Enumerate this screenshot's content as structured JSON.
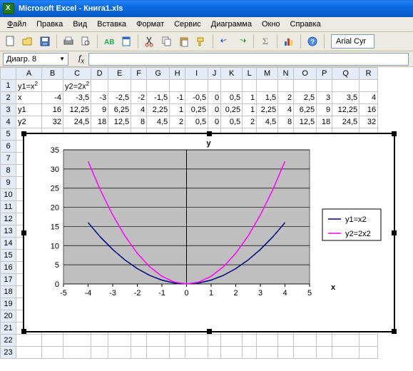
{
  "window": {
    "title": "Microsoft Excel - Книга1.xls"
  },
  "menu": {
    "file": "Файл",
    "edit": "Правка",
    "view": "Вид",
    "insert": "Вставка",
    "format": "Формат",
    "service": "Сервис",
    "chart": "Диаграмма",
    "window": "Окно",
    "help": "Справка"
  },
  "font": {
    "name": "Arial Cyr"
  },
  "namebox": {
    "value": "Диагр. 8"
  },
  "columns": [
    "A",
    "B",
    "C",
    "D",
    "E",
    "F",
    "G",
    "H",
    "I",
    "J",
    "K",
    "L",
    "M",
    "N",
    "O",
    "P",
    "Q",
    "R"
  ],
  "rows": [
    "1",
    "2",
    "3",
    "4",
    "5",
    "6",
    "7",
    "8",
    "9",
    "10",
    "11",
    "12",
    "13",
    "14",
    "15",
    "16",
    "17",
    "18",
    "19",
    "20",
    "21",
    "22",
    "23"
  ],
  "cells": {
    "r1": {
      "A": "y1=x",
      "C": "y2=2x"
    },
    "sup": "2",
    "r2": {
      "A": "x",
      "B": "-4",
      "C": "-3,5",
      "D": "-3",
      "E": "-2,5",
      "F": "-2",
      "G": "-1,5",
      "H": "-1",
      "I": "-0,5",
      "J": "0",
      "K": "0,5",
      "L": "1",
      "M": "1,5",
      "N": "2",
      "O": "2,5",
      "P": "3",
      "Q": "3,5",
      "R": "4"
    },
    "r3": {
      "A": "y1",
      "B": "16",
      "C": "12,25",
      "D": "9",
      "E": "6,25",
      "F": "4",
      "G": "2,25",
      "H": "1",
      "I": "0,25",
      "J": "0",
      "K": "0,25",
      "L": "1",
      "M": "2,25",
      "N": "4",
      "O": "6,25",
      "P": "9",
      "Q": "12,25",
      "R": "16"
    },
    "r4": {
      "A": "y2",
      "B": "32",
      "C": "24,5",
      "D": "18",
      "E": "12,5",
      "F": "8",
      "G": "4,5",
      "H": "2",
      "I": "0,5",
      "J": "0",
      "K": "0,5",
      "L": "2",
      "M": "4,5",
      "N": "8",
      "O": "12,5",
      "P": "18",
      "Q": "24,5",
      "R": "32"
    }
  },
  "chart_data": {
    "type": "line",
    "title_y": "y",
    "xlabel": "x",
    "x": [
      -5,
      -4,
      -3,
      -2,
      -1,
      0,
      1,
      2,
      3,
      4,
      5
    ],
    "xgrid": [
      -5,
      -4,
      -3,
      -2,
      -1,
      0,
      1,
      2,
      3,
      4,
      5
    ],
    "ygrid": [
      0,
      5,
      10,
      15,
      20,
      25,
      30,
      35
    ],
    "xlim": [
      -5,
      5
    ],
    "ylim": [
      0,
      35
    ],
    "series": [
      {
        "name": "y1=x2",
        "color": "#000080",
        "x": [
          -4,
          -3.5,
          -3,
          -2.5,
          -2,
          -1.5,
          -1,
          -0.5,
          0,
          0.5,
          1,
          1.5,
          2,
          2.5,
          3,
          3.5,
          4
        ],
        "y": [
          16,
          12.25,
          9,
          6.25,
          4,
          2.25,
          1,
          0.25,
          0,
          0.25,
          1,
          2.25,
          4,
          6.25,
          9,
          12.25,
          16
        ]
      },
      {
        "name": "y2=2x2",
        "color": "#ff00ff",
        "x": [
          -4,
          -3.5,
          -3,
          -2.5,
          -2,
          -1.5,
          -1,
          -0.5,
          0,
          0.5,
          1,
          1.5,
          2,
          2.5,
          3,
          3.5,
          4
        ],
        "y": [
          32,
          24.5,
          18,
          12.5,
          8,
          4.5,
          2,
          0.5,
          0,
          0.5,
          2,
          4.5,
          8,
          12.5,
          18,
          24.5,
          32
        ]
      }
    ],
    "legend": {
      "items": [
        "y1=x2",
        "y2=2x2"
      ]
    }
  }
}
